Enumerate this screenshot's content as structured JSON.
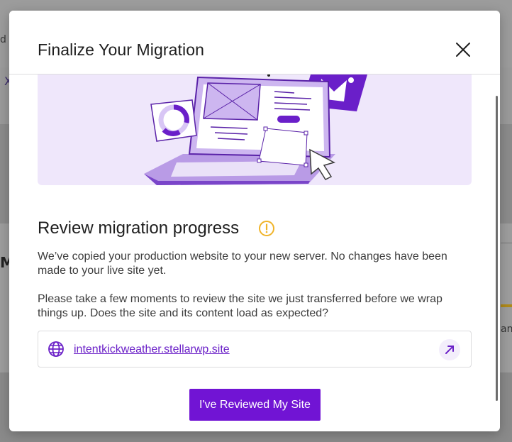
{
  "background": {
    "fragment_left_top": "d e",
    "fragment_x": "X",
    "fragment_heading": "M",
    "fragment_right": "an"
  },
  "modal": {
    "title": "Finalize Your Migration",
    "close_icon": "close-icon",
    "illustration": "laptop-migration-illustration",
    "section_title": "Review migration progress",
    "warning_icon": "warning-circle-icon",
    "paragraph1": "We’ve copied your production website to your new server. No changes have been made to your live site yet.",
    "paragraph2": "Please take a few moments to review the site we just transferred before we wrap things up. Does the site and its content load as expected?",
    "site_url": "intentkickweather.stellarwp.site",
    "globe_icon": "globe-icon",
    "open_icon": "external-arrow-icon",
    "primary_button": "I've Reviewed My Site"
  },
  "colors": {
    "accent": "#7114d4",
    "hero_bg": "#efe7fb",
    "warning": "#f0b429"
  }
}
